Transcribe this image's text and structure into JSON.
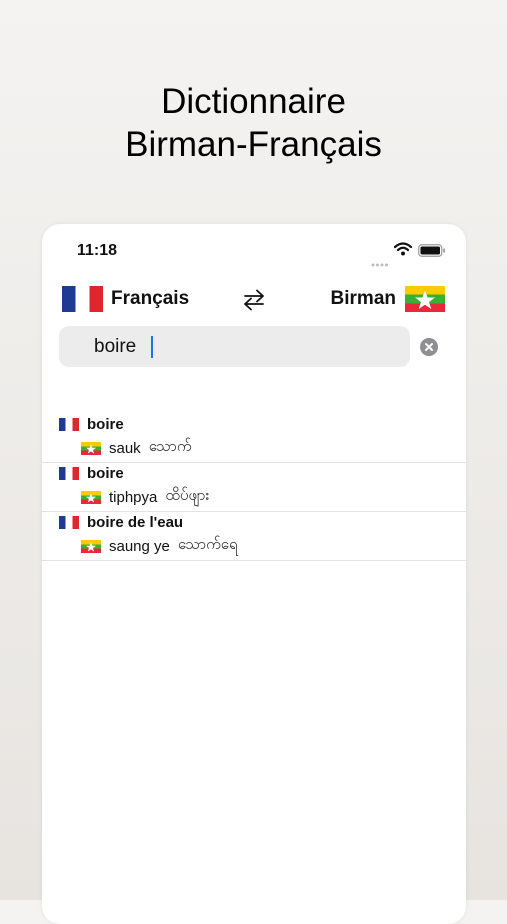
{
  "headline": {
    "line1": "Dictionnaire",
    "line2": "Birman-Français"
  },
  "status": {
    "time": "11:18"
  },
  "lang": {
    "source": "Français",
    "target": "Birman"
  },
  "search": {
    "value": "boire",
    "placeholder": ""
  },
  "results": [
    {
      "source": "boire",
      "target": "sauk",
      "target_script": "သောက်"
    },
    {
      "source": "boire",
      "target": "tiphpya",
      "target_script": "ထိပ်ဖျား"
    },
    {
      "source": "boire de l'eau",
      "target": "saung ye",
      "target_script": "သောက်ရေ"
    }
  ],
  "colors": {
    "cursor": "#1a73e8",
    "search_bg": "#ececec",
    "clear_icon": "#8e8e93"
  },
  "icons": [
    "signal-dots-icon",
    "wifi-icon",
    "battery-icon",
    "swap-arrows-icon",
    "clear-icon",
    "france-flag-icon",
    "myanmar-flag-icon"
  ]
}
